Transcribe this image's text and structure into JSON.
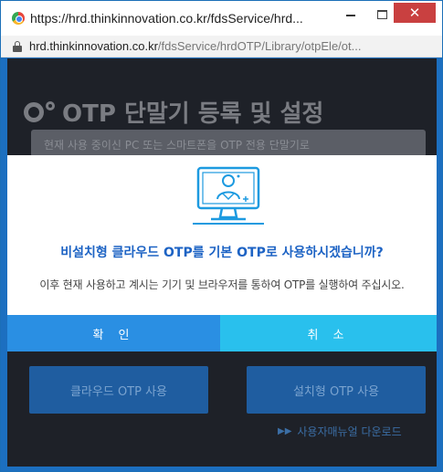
{
  "window": {
    "title": "https://hrd.thinkinnovation.co.kr/fdsService/hrd...",
    "minimize_label": "–",
    "close_label": "✕",
    "url_host": "hrd.thinkinnovation.co.kr",
    "url_path": "/fdsService/hrdOTP/Library/otpEle/ot..."
  },
  "page": {
    "title": "OTP 단말기 등록 및 설정",
    "banner_text": "현재 사용 중이신 PC 또는 스마트폰을 OTP 전용 단말기로",
    "cloud_button": "클라우드 OTP 사용",
    "install_button": "설치형 OTP 사용",
    "manual_link": "사용자매뉴얼 다운로드",
    "manual_arrow": "▶▶"
  },
  "modal": {
    "question": "비설치형 클라우드 OTP를 기본 OTP로 사용하시겠습니까?",
    "description": "이후 현재 사용하고 계시는 기기 및 브라우저를 통하여 OTP를 실행하여 주십시오.",
    "confirm_label": "확 인",
    "cancel_label": "취 소"
  },
  "colors": {
    "accent_blue": "#1d63c4",
    "confirm_bg": "#2a8fe3",
    "cancel_bg": "#29c0ed",
    "page_bg": "#1e2128",
    "close_red": "#c94040"
  },
  "icons": {
    "favicon": "browser-favicon-icon",
    "lock": "lock-icon",
    "gear": "gear-icon",
    "monitor": "monitor-user-icon"
  }
}
